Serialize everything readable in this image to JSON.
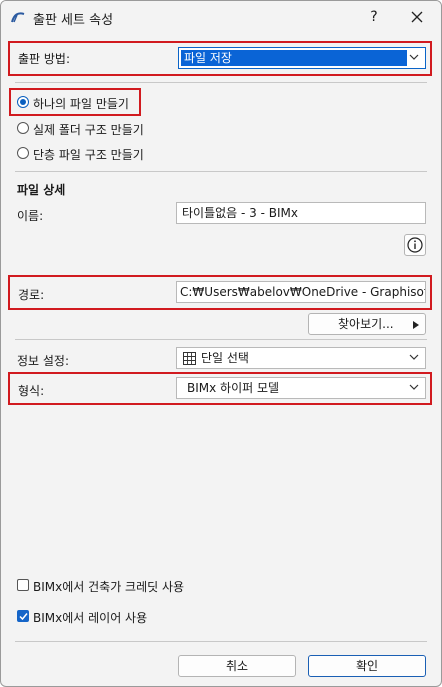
{
  "window": {
    "title": "출판 세트 속성",
    "help_glyph": "?",
    "close_glyph": "✕"
  },
  "publish_method": {
    "label": "출판 방법:",
    "value": "파일 저장"
  },
  "mode_options": [
    {
      "label": "하나의 파일 만들기",
      "selected": true
    },
    {
      "label": "실제 폴더 구조 만들기",
      "selected": false
    },
    {
      "label": "단층 파일 구조 만들기",
      "selected": false
    }
  ],
  "file_details": {
    "heading": "파일 상세",
    "name_label": "이름:",
    "name_value": "타이틀없음 - 3 - BIMx",
    "path_label": "경로:",
    "path_value": "C:₩Users₩abelov₩OneDrive - Graphisoft SE₩LC",
    "browse_label": "찾아보기..."
  },
  "info_settings": {
    "label": "정보 설정:",
    "value": "단일 선택",
    "icon": "grid-icon"
  },
  "format": {
    "label": "형식:",
    "value": "BIMx 하이퍼 모델"
  },
  "checkboxes": [
    {
      "label": "BIMx에서 건축가 크레딧 사용",
      "checked": false
    },
    {
      "label": "BIMx에서 레이어 사용",
      "checked": true
    }
  ],
  "footer": {
    "cancel_label": "취소",
    "ok_label": "확인"
  },
  "colors": {
    "highlight_red": "#d11a1f",
    "selection_blue": "#0a64d6",
    "check_blue": "#1565c8"
  }
}
